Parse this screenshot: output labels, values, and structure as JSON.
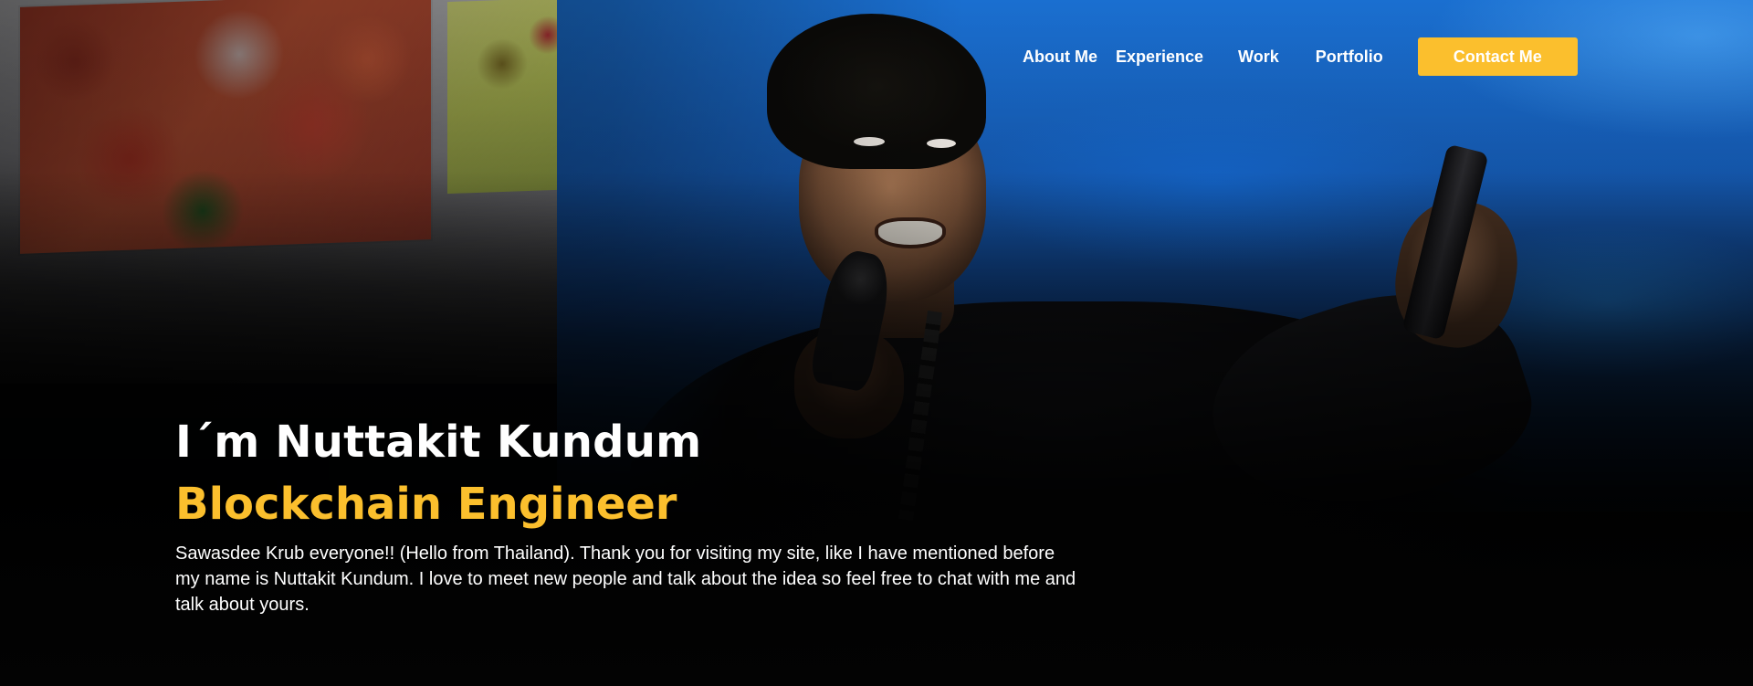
{
  "nav": {
    "items": [
      {
        "label": "About Me"
      },
      {
        "label": "Experience"
      },
      {
        "label": "Work"
      },
      {
        "label": "Portfolio"
      }
    ],
    "contact_label": "Contact Me"
  },
  "hero": {
    "name": "I´m Nuttakit Kundum",
    "role": "Blockchain Engineer",
    "description": "Sawasdee Krub everyone!! (Hello from Thailand). Thank you for visiting my site, like I have mentioned before my name is Nuttakit Kundum. I love to meet new people and talk about the idea so feel free to chat with me and talk about yours."
  },
  "colors": {
    "accent": "#fbbf2d",
    "text": "#ffffff",
    "background": "#030303"
  }
}
